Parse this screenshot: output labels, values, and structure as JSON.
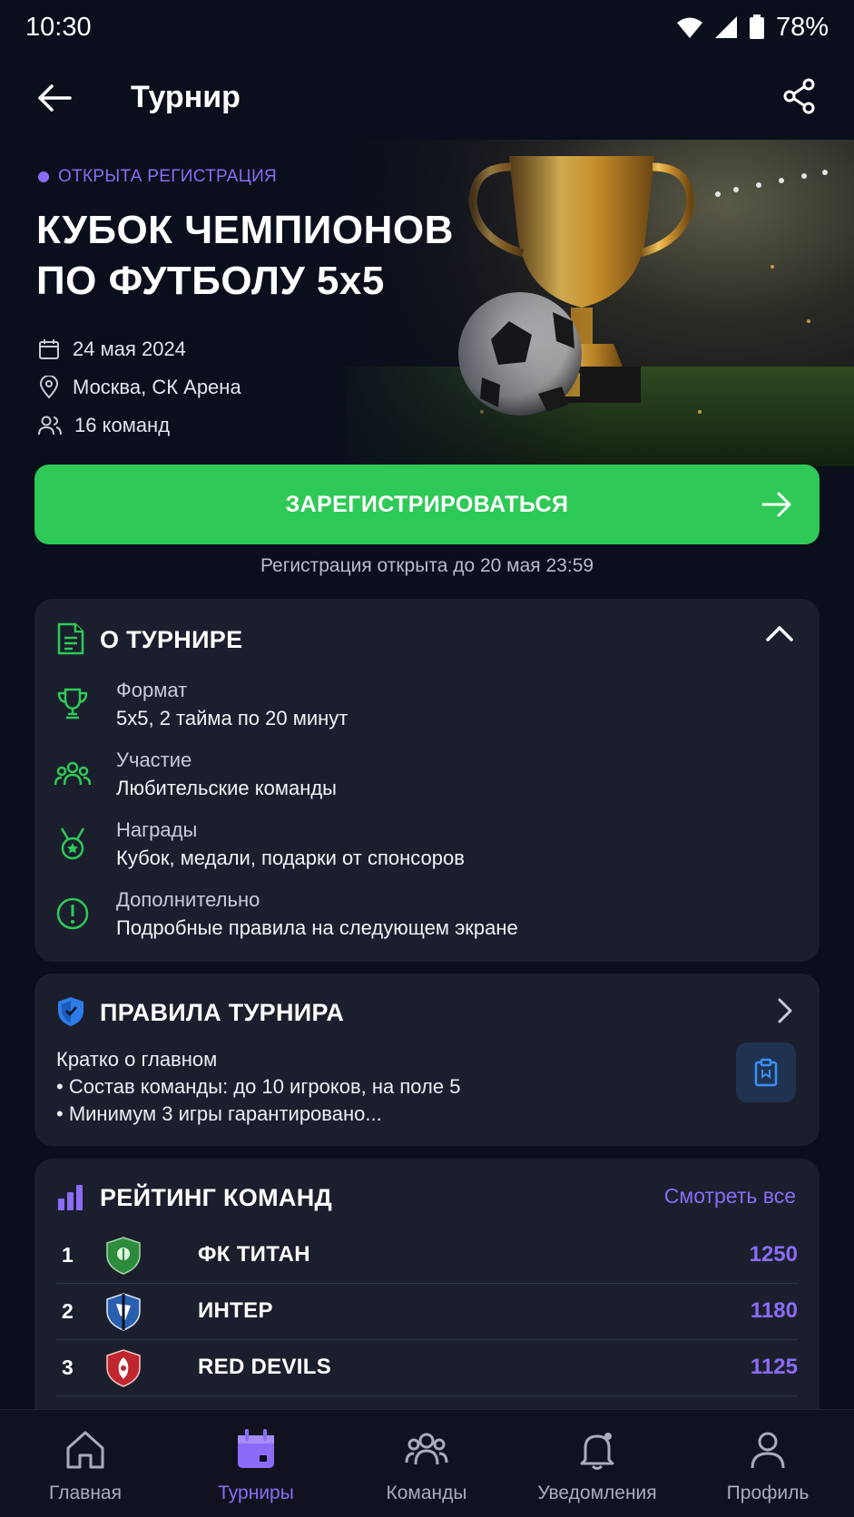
{
  "status_bar": {
    "time": "10:30",
    "battery": "78%"
  },
  "header": {
    "title": "Турнир"
  },
  "hero": {
    "status": "ОТКРЫТА РЕГИСТРАЦИЯ",
    "title_line1": "КУБОК ЧЕМПИОНОВ",
    "title_line2": "ПО ФУТБОЛУ 5x5",
    "date": "24 мая 2024",
    "location": "Москва, СК Арена",
    "teams": "16 команд"
  },
  "register": {
    "label": "ЗАРЕГИСТРИРОВАТЬСЯ",
    "deadline": "Регистрация открыта до 20 мая 23:59"
  },
  "about": {
    "title": "О ТУРНИРЕ",
    "items": [
      {
        "icon": "trophy-icon",
        "label": "Формат",
        "value": "5x5, 2 тайма по 20 минут"
      },
      {
        "icon": "group-icon",
        "label": "Участие",
        "value": "Любительские команды"
      },
      {
        "icon": "medal-icon",
        "label": "Награды",
        "value": "Кубок, медали, подарки от спонсоров"
      },
      {
        "icon": "info-icon",
        "label": "Дополнительно",
        "value": "Подробные правила на следующем экране"
      }
    ]
  },
  "rules": {
    "title": "ПРАВИЛА ТУРНИРА",
    "line1": "Кратко о главном",
    "line2": "• Состав команды: до 10 игроков, на поле 5",
    "line3": "• Минимум 3 игры гарантировано..."
  },
  "rating": {
    "title": "РЕЙТИНГ КОМАНД",
    "see_all": "Смотреть все",
    "rows": [
      {
        "rank": "1",
        "name": "ФК ТИТАН",
        "points": "1250",
        "color": "#2e8b3e"
      },
      {
        "rank": "2",
        "name": "ИНТЕР",
        "points": "1180",
        "color": "#2a5fb0"
      },
      {
        "rank": "3",
        "name": "RED DEVILS",
        "points": "1125",
        "color": "#c0262d"
      }
    ]
  },
  "nav": [
    {
      "label": "Главная",
      "icon": "home-icon"
    },
    {
      "label": "Турниры",
      "icon": "calendar-icon",
      "active": true
    },
    {
      "label": "Команды",
      "icon": "teams-icon"
    },
    {
      "label": "Уведомления",
      "icon": "bell-icon"
    },
    {
      "label": "Профиль",
      "icon": "profile-icon"
    }
  ],
  "colors": {
    "accent": "#8a6cf6",
    "primary_green": "#2fc957",
    "background": "#0b0f1c",
    "card": "#1b1f2d"
  }
}
